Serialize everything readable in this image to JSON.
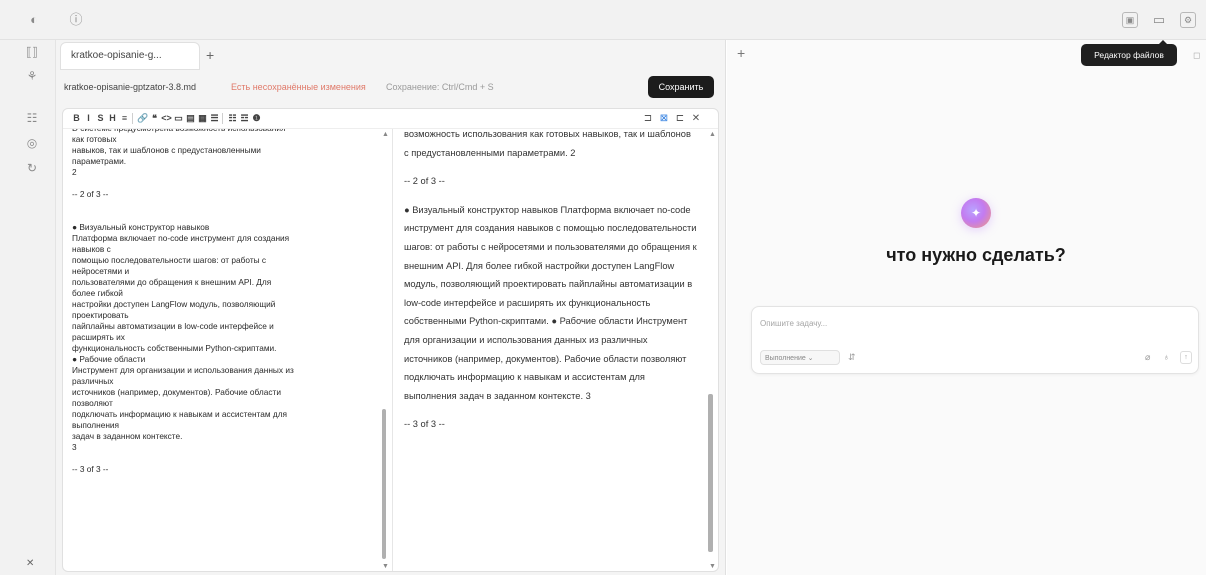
{
  "editor": {
    "tab_label": "kratkoe-opisanie-g...",
    "file_name": "kratkoe-opisanie-gptzator-3.8.md",
    "unsaved_text": "Есть несохранённые изменения",
    "save_hint": "Сохранение: Ctrl/Cmd + S",
    "save_button": "Сохранить",
    "source_text": "D системе предусмотрена возможность использования\nкак готовых\nнавыков, так и шаблонов с предустановленными\nпараметрами.\n2\n\n-- 2 of 3 --\n\n\n● Визуальный конструктор навыков\nПлатформа включает no-code инструмент для создания\nнавыков с\nпомощью последовательности шагов: от работы с\nнейросетями и\nпользователями до обращения к внешним API. Для\nболее гибкой\nнастройки доступен LangFlow модуль, позволяющий\nпроектировать\nпайплайны автоматизации в low-code интерфейсе и\nрасширять их\nфункциональность собственными Python-скриптами.\n● Рабочие области\nИнструмент для организации и использования данных из\nразличных\nисточников (например, документов). Рабочие области\nпозволяют\nподключать информацию к навыкам и ассистентам для\nвыполнения\nзадач в заданном контексте.\n3\n\n-- 3 of 3 --",
    "preview_paragraphs": [
      "возможность использования как готовых навыков, так и шаблонов с предустановленными параметрами. 2",
      "-- 2 of 3 --",
      "● Визуальный конструктор навыков Платформа включает no-code инструмент для создания навыков с помощью последовательности шагов: от работы с нейросетями и пользователями до обращения к внешним API. Для более гибкой настройки доступен LangFlow модуль, позволяющий проектировать пайплайны автоматизации в low-code интерфейсе и расширять их функциональность собственными Python-скриптами. ● Рабочие области Инструмент для организации и использования данных из различных источников (например, документов). Рабочие области позволяют подключать информацию к навыкам и ассистентам для выполнения задач в заданном контексте. 3",
      "-- 3 of 3 --"
    ]
  },
  "toolbar_glyphs": [
    "B",
    "I",
    "S",
    "H",
    "≡",
    "🔗",
    "❝",
    "<>",
    "▭",
    "▤",
    "▦",
    "☰",
    "☷",
    "☲",
    "❶"
  ],
  "view_toggle_glyphs": [
    "⊐",
    "⊠",
    "⊏",
    "✕"
  ],
  "assistant": {
    "tooltip": "Редактор файлов",
    "title": "что нужно сделать?",
    "input_placeholder": "Опишите задачу...",
    "mode_label": "Выполнение ⌄"
  },
  "icons": {
    "top_left": [
      "sidebar-toggle-icon",
      "info-icon"
    ],
    "top_right": [
      "file-editor-icon",
      "folder-icon",
      "settings-icon"
    ],
    "rail": [
      "workspace-icon",
      "skills-icon",
      "data-icon",
      "globe-icon",
      "history-icon",
      "close-icon"
    ],
    "input": [
      "mode-icon",
      "attach-icon",
      "mic-icon",
      "send-icon"
    ]
  }
}
